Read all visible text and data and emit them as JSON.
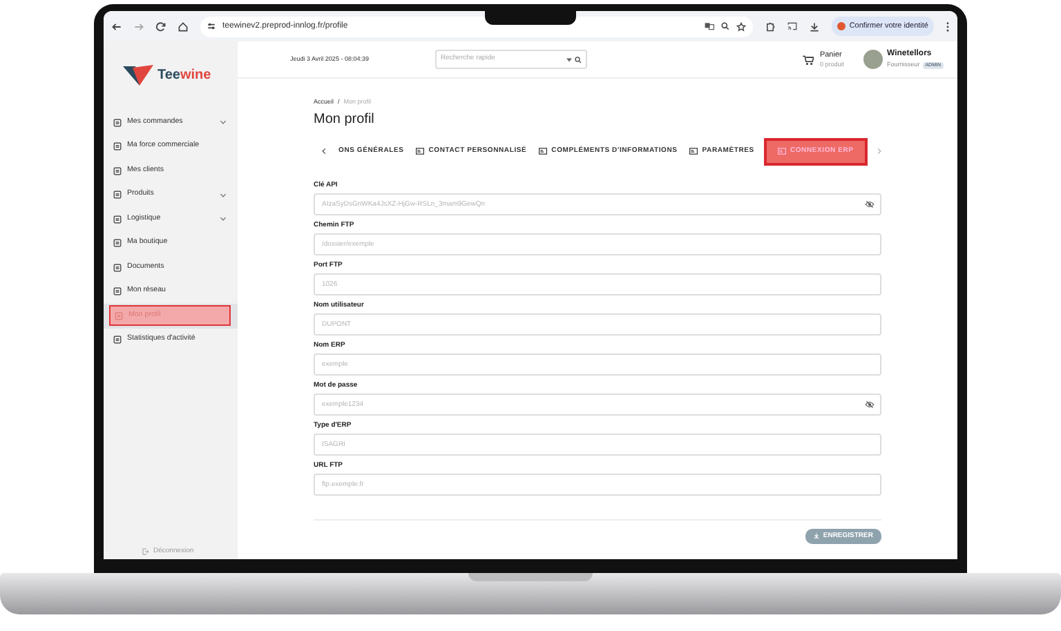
{
  "browser": {
    "url": "teewinev2.preprod-innlog.fr/profile",
    "identity_button": "Confirmer votre identité"
  },
  "sidebar": {
    "logo": [
      "Tee",
      "wine"
    ],
    "items": [
      {
        "label": "Mes commandes",
        "expandable": true,
        "selected": false
      },
      {
        "label": "Ma force commerciale",
        "expandable": false,
        "selected": false
      },
      {
        "label": "Mes clients",
        "expandable": false,
        "selected": false
      },
      {
        "label": "Produits",
        "expandable": true,
        "selected": false
      },
      {
        "label": "Logistique",
        "expandable": true,
        "selected": false
      },
      {
        "label": "Ma boutique",
        "expandable": false,
        "selected": false
      },
      {
        "label": "Documents",
        "expandable": false,
        "selected": false
      },
      {
        "label": "Mon réseau",
        "expandable": false,
        "selected": false
      },
      {
        "label": "Mon profil",
        "expandable": false,
        "selected": true
      },
      {
        "label": "Statistiques d'activité",
        "expandable": false,
        "selected": false
      }
    ],
    "footer": "Déconnexion"
  },
  "header": {
    "date": "Jeudi 3 Avril 2025 - 08:04:39",
    "search": {
      "placeholder": "Recherche rapide"
    },
    "cart": {
      "label": "Panier",
      "count": "0 produit"
    },
    "user": {
      "name": "Winetellors",
      "role": "Fournisseur",
      "badge": "ADMIN"
    }
  },
  "breadcrumb": [
    "Accueil",
    "/",
    "Mon profil"
  ],
  "title": "Mon profil",
  "tabs": [
    {
      "label": "ONS GÉNÉRALES",
      "selected": false
    },
    {
      "label": "CONTACT PERSONNALISÉ",
      "selected": false
    },
    {
      "label": "COMPLÉMENTS D'INFORMATIONS",
      "selected": false
    },
    {
      "label": "PARAMÈTRES",
      "selected": false
    },
    {
      "label": "CONNEXION ERP",
      "selected": true
    }
  ],
  "fields": [
    {
      "label": "Clé API",
      "placeholder": "AIzaSyDsGnWKa4JsXZ-HjGw-RSLn_3mam9GewQn",
      "kind": "secret"
    },
    {
      "label": "Chemin FTP",
      "placeholder": "/dossier/exemple",
      "kind": "text"
    },
    {
      "label": "Port FTP",
      "placeholder": "1026",
      "kind": "text"
    },
    {
      "label": "Nom utilisateur",
      "placeholder": "DUPONT",
      "kind": "text"
    },
    {
      "label": "Nom ERP",
      "placeholder": "exemple",
      "kind": "text"
    },
    {
      "label": "Mot de passe",
      "placeholder": "exemple1234",
      "kind": "secret"
    },
    {
      "label": "Type d'ERP",
      "placeholder": "ISAGRI",
      "kind": "text"
    },
    {
      "label": "URL FTP",
      "placeholder": "ftp.exemple.fr",
      "kind": "text"
    }
  ],
  "save_button": "ENREGISTRER"
}
